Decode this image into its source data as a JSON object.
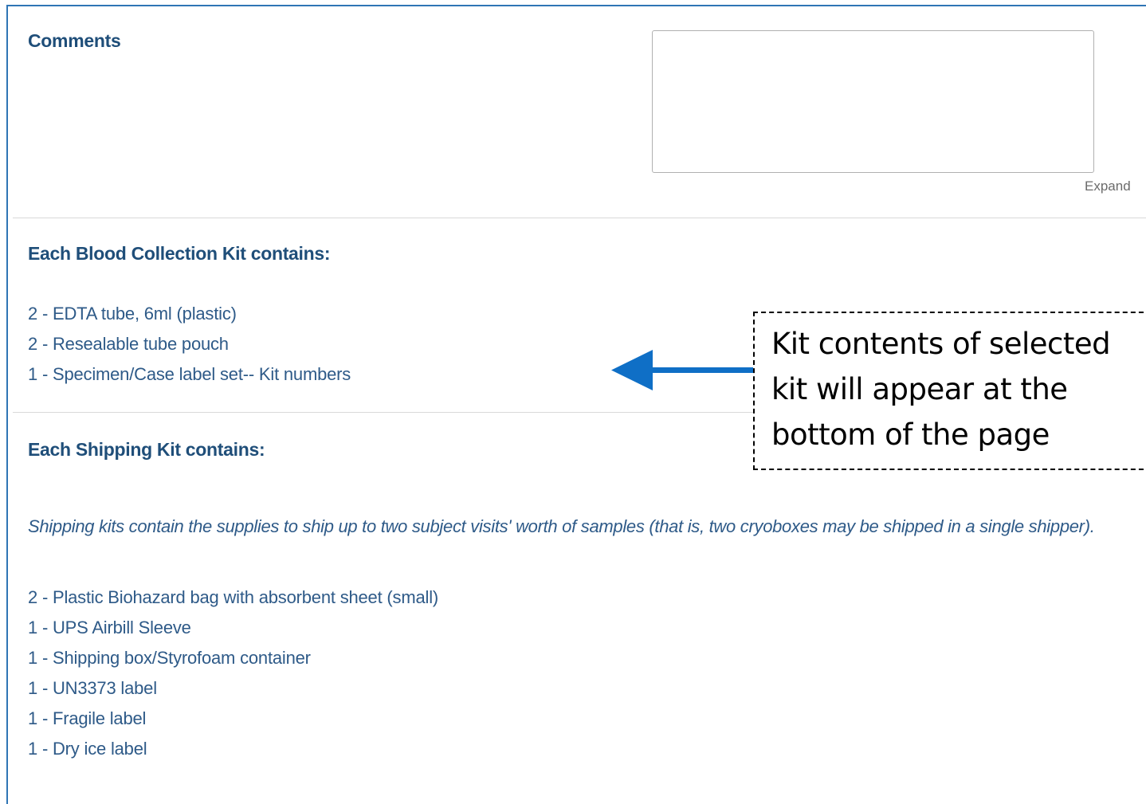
{
  "comments": {
    "label": "Comments",
    "value": "",
    "expand_label": "Expand"
  },
  "blood_kit": {
    "heading": "Each Blood Collection Kit contains:",
    "items": [
      "2 - EDTA tube, 6ml (plastic)",
      "2 - Resealable tube pouch",
      "1 - Specimen/Case label set-- Kit numbers"
    ]
  },
  "shipping_kit": {
    "heading": "Each Shipping Kit contains:",
    "note": "Shipping kits contain the supplies to ship up to two subject visits' worth of samples (that is, two cryoboxes may be shipped in a single shipper).",
    "items": [
      "2 - Plastic Biohazard bag with absorbent sheet (small)",
      "1 - UPS Airbill Sleeve",
      "1 - Shipping box/Styrofoam container",
      "1 - UN3373 label",
      "1 - Fragile label",
      "1 - Dry ice label"
    ]
  },
  "callout": {
    "text": "Kit contents of selected kit will appear at the bottom of the page"
  },
  "colors": {
    "accent": "#2f75b5",
    "text": "#1f4e79",
    "arrow": "#0f6fc6"
  },
  "icons": {
    "arrow": "arrow-left-icon"
  }
}
